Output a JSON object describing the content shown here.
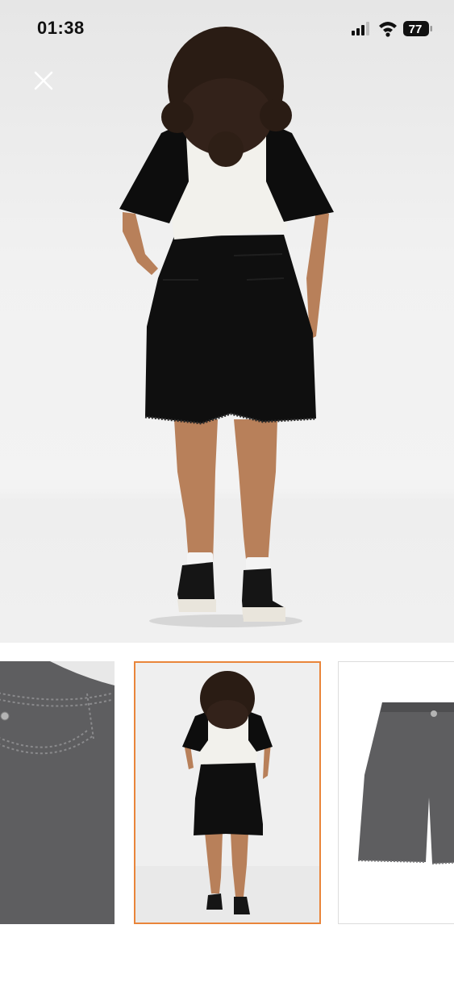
{
  "status_bar": {
    "time": "01:38",
    "battery_level": "77",
    "icons": [
      "cellular-signal-icon",
      "wifi-icon",
      "battery-icon"
    ]
  },
  "viewer": {
    "close_icon": "close-icon",
    "main_image": "product-photo-back-view"
  },
  "thumbnails": [
    {
      "name": "fabric-detail-closeup",
      "selected": false
    },
    {
      "name": "model-back-view",
      "selected": true
    },
    {
      "name": "product-flat-lay",
      "selected": false
    }
  ],
  "colors": {
    "selection_border": "#e9853a",
    "denim_grey": "#5e5e60",
    "shorts_black": "#0f0f0f"
  }
}
